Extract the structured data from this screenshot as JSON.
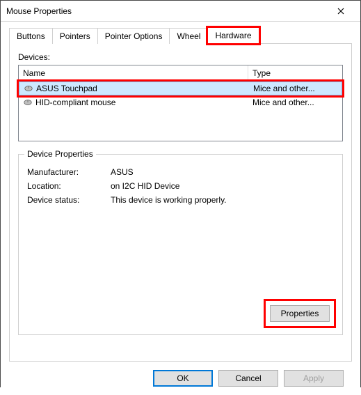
{
  "window": {
    "title": "Mouse Properties"
  },
  "tabs": {
    "items": [
      {
        "label": "Buttons"
      },
      {
        "label": "Pointers"
      },
      {
        "label": "Pointer Options"
      },
      {
        "label": "Wheel"
      },
      {
        "label": "Hardware"
      }
    ],
    "activeIndex": 4
  },
  "devices": {
    "label": "Devices:",
    "columns": {
      "name": "Name",
      "type": "Type"
    },
    "rows": [
      {
        "name": "ASUS Touchpad",
        "type": "Mice and other...",
        "selected": true
      },
      {
        "name": "HID-compliant mouse",
        "type": "Mice and other...",
        "selected": false
      }
    ]
  },
  "properties": {
    "legend": "Device Properties",
    "manufacturer_k": "Manufacturer:",
    "manufacturer_v": "ASUS",
    "location_k": "Location:",
    "location_v": "on I2C HID Device",
    "status_k": "Device status:",
    "status_v": "This device is working properly.",
    "button": "Properties"
  },
  "footer": {
    "ok": "OK",
    "cancel": "Cancel",
    "apply": "Apply"
  }
}
